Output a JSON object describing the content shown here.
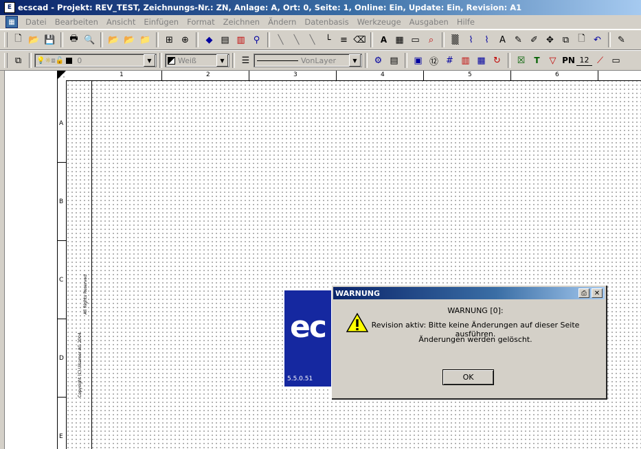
{
  "window": {
    "title": "ecscad - Projekt: REV_TEST, Zeichnungs-Nr.: ZN, Anlage: A, Ort: 0, Seite: 1, Online: Ein, Update: Ein, Revision: A1",
    "app_icon": "ecscad-app-icon"
  },
  "menu": [
    "Datei",
    "Bearbeiten",
    "Ansicht",
    "Einfügen",
    "Format",
    "Zeichnen",
    "Ändern",
    "Datenbasis",
    "Werkzeuge",
    "Ausgaben",
    "Hilfe"
  ],
  "toolbar2": {
    "layer_value": "0",
    "color_value": "Weiß",
    "linetype_value": "VonLayer",
    "pn_label": "PN",
    "num_label": "12"
  },
  "ruler": {
    "columns": [
      "1",
      "2",
      "3",
      "4",
      "5",
      "6"
    ],
    "rows": [
      "A",
      "B",
      "C",
      "D",
      "E"
    ]
  },
  "copyright": {
    "line1": "Copyright (C) Ulsamer AG 2004",
    "line2": "All Rights Reserved"
  },
  "splash": {
    "logo": "ec",
    "version": "5.5.0.51"
  },
  "dialog": {
    "title": "WARNUNG",
    "heading": "WARNUNG [0]:",
    "line1": "Revision aktiv: Bitte keine Änderungen auf dieser Seite ausführen.",
    "line2": "Änderungen werden gelöscht.",
    "ok_label": "OK"
  }
}
